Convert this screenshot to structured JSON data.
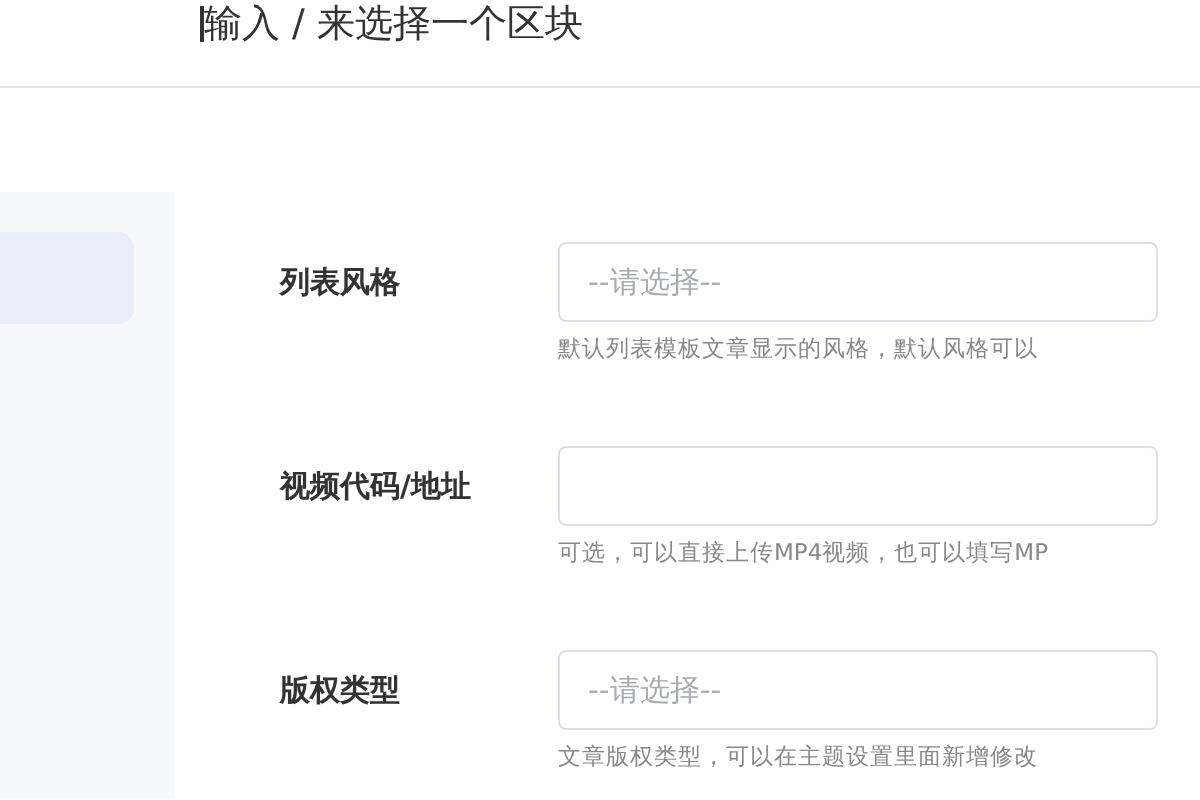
{
  "header": {
    "breadcrumb": "输入 / 来选择一个区块",
    "cursor": true
  },
  "sidebar": {
    "items": [
      {
        "selected": true
      }
    ]
  },
  "form": {
    "fields": [
      {
        "label": "列表风格",
        "placeholder": "--请选择--",
        "help": "默认列表模板文章显示的风格，默认风格可以"
      },
      {
        "label": "视频代码/地址",
        "help": "可选，可以直接上传MP4视频，也可以填写MP"
      },
      {
        "label": "版权类型",
        "placeholder": "--请选择--",
        "help": "文章版权类型，可以在主题设置里面新增修改"
      }
    ]
  }
}
